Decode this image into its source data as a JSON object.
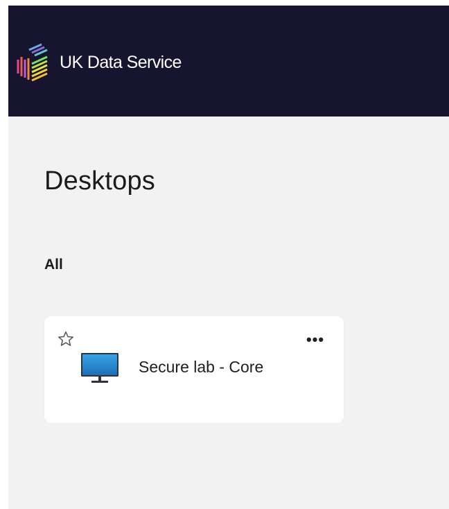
{
  "header": {
    "brand_name": "UK Data Service",
    "background_color": "#17142f",
    "logo_icon": "ukds-cube-logo-icon"
  },
  "main": {
    "title": "Desktops",
    "section_label": "All",
    "desktops": [
      {
        "name": "Secure lab - Core",
        "icon": "monitor-icon",
        "favorite": false,
        "menu_label": "•••"
      }
    ]
  }
}
